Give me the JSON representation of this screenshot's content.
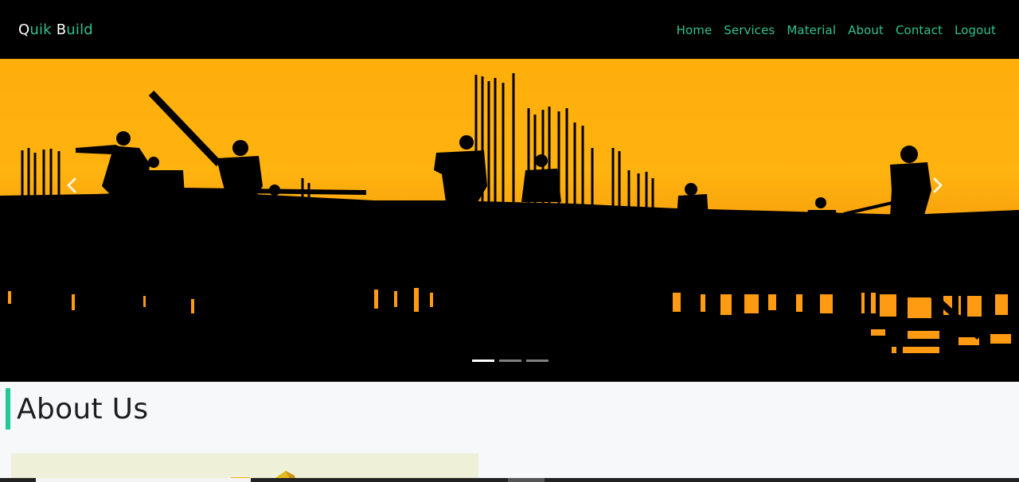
{
  "navbar": {
    "brand_q": "Q",
    "brand_uik": "uik ",
    "brand_b": "B",
    "brand_uild": "uild",
    "links": [
      "Home",
      "Services",
      "Material",
      "About",
      "Contact",
      "Logout"
    ]
  },
  "hero": {
    "prev_icon": "chevron-left-icon",
    "next_icon": "chevron-right-icon",
    "slides": 3,
    "active_slide": 1
  },
  "about": {
    "heading": "About Us",
    "accent_color": "#20c997"
  },
  "colors": {
    "nav_bg": "#000000",
    "nav_link": "#2fc28f",
    "page_bg": "#f6f8f9"
  }
}
